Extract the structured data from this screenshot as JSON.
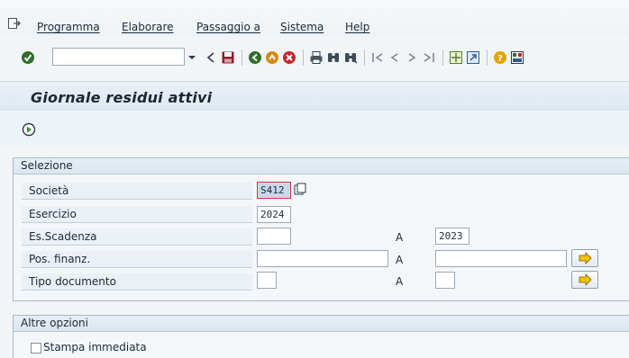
{
  "menubar": {
    "items": [
      "Programma",
      "Elaborare",
      "Passaggio a",
      "Sistema",
      "Help"
    ]
  },
  "toolbar": {
    "command_field_value": "",
    "icons": [
      "enter-icon",
      "back-icon",
      "save-icon",
      "back-nav-icon",
      "exit-icon",
      "cancel-icon",
      "print-icon",
      "find-icon",
      "find-next-icon",
      "first-page-icon",
      "prev-page-icon",
      "next-page-icon",
      "last-page-icon",
      "new-session-icon",
      "shortcut-icon",
      "help-icon",
      "layout-icon"
    ]
  },
  "page": {
    "title": "Giornale residui attivi"
  },
  "selection": {
    "title": "Selezione",
    "fields": [
      {
        "label": "Società",
        "from": "S412"
      },
      {
        "label": "Esercizio",
        "from": "2024"
      },
      {
        "label": "Es.Scadenza",
        "from": "",
        "to_label": "A",
        "to": "2023"
      },
      {
        "label": "Pos. finanz.",
        "from": "",
        "to_label": "A",
        "to": ""
      },
      {
        "label": "Tipo documento",
        "from": "",
        "to_label": "A",
        "to": ""
      }
    ]
  },
  "options": {
    "title": "Altre opzioni",
    "print_immediately_label": "Stampa immediata",
    "print_immediately_checked": false
  },
  "colors": {
    "accent_green": "#3c8c32",
    "arrow_yellow": "#f5c400",
    "selected_field": "#c9d7ea",
    "focus_border": "#d43a3a"
  }
}
